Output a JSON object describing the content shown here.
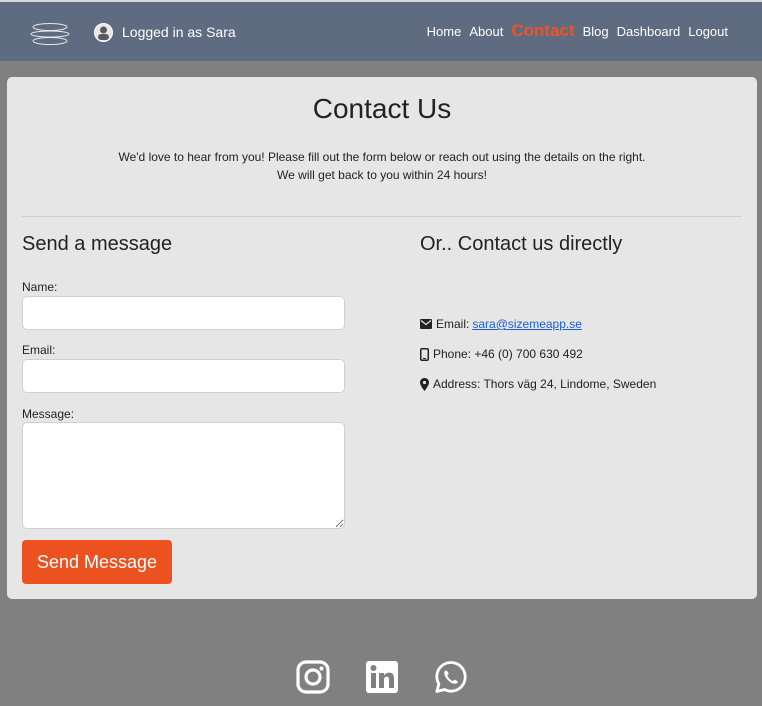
{
  "nav": {
    "logged_in_text": "Logged in as Sara",
    "links": [
      "Home",
      "About",
      "Contact",
      "Blog",
      "Dashboard",
      "Logout"
    ],
    "active_link": "Contact"
  },
  "page": {
    "title": "Contact Us",
    "intro_line1": "We'd love to hear from you! Please fill out the form below or reach out using the details on the right.",
    "intro_line2": "We will get back to you within 24 hours!"
  },
  "form": {
    "heading": "Send a message",
    "name_label": "Name:",
    "name_value": "",
    "email_label": "Email:",
    "email_value": "",
    "message_label": "Message:",
    "message_value": "",
    "submit_label": "Send Message"
  },
  "direct": {
    "heading": "Or.. Contact us directly",
    "email_label": "Email:",
    "email_value": "sara@sizemeapp.se",
    "phone_text": "Phone: +46 (0) 700 630 492",
    "address_text": "Address: Thors väg 24, Lindome, Sweden"
  },
  "social": {
    "icons": [
      "instagram-icon",
      "linkedin-icon",
      "whatsapp-icon"
    ]
  },
  "colors": {
    "navbar_bg": "#5e6b80",
    "accent": "#ec5120",
    "page_bg": "#808080",
    "card_bg": "#e6e6e6",
    "link": "#1a5fd6"
  }
}
